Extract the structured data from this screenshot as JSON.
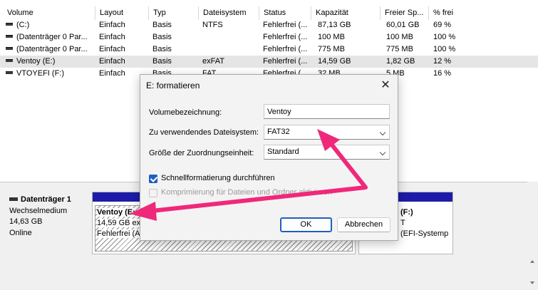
{
  "columns": [
    "Volume",
    "Layout",
    "Typ",
    "Dateisystem",
    "Status",
    "Kapazität",
    "Freier Sp...",
    "% frei"
  ],
  "volumes": [
    {
      "volume": "(C:)",
      "layout": "Einfach",
      "typ": "Basis",
      "fs": "NTFS",
      "status": "Fehlerfrei (...",
      "capacity": "87,13 GB",
      "free": "60,01 GB",
      "pct": "69 %"
    },
    {
      "volume": "(Datenträger 0 Par...",
      "layout": "Einfach",
      "typ": "Basis",
      "fs": "",
      "status": "Fehlerfrei (...",
      "capacity": "100 MB",
      "free": "100 MB",
      "pct": "100 %"
    },
    {
      "volume": "(Datenträger 0 Par...",
      "layout": "Einfach",
      "typ": "Basis",
      "fs": "",
      "status": "Fehlerfrei (...",
      "capacity": "775 MB",
      "free": "775 MB",
      "pct": "100 %"
    },
    {
      "volume": "Ventoy (E:)",
      "layout": "Einfach",
      "typ": "Basis",
      "fs": "exFAT",
      "status": "Fehlerfrei (...",
      "capacity": "14,59 GB",
      "free": "1,82 GB",
      "pct": "12 %"
    },
    {
      "volume": "VTOYEFI (F:)",
      "layout": "Einfach",
      "typ": "Basis",
      "fs": "FAT",
      "status": "Fehlerfrei (...",
      "capacity": "32 MB",
      "free": "5 MB",
      "pct": "16 %"
    }
  ],
  "disk": {
    "name": "Datenträger 1",
    "type": "Wechselmedium",
    "size": "14,63 GB",
    "state": "Online",
    "partitions": [
      {
        "name": "Ventoy  (E:",
        "line2": "14,59 GB ex",
        "line3": "Fehlerfrei (A"
      },
      {
        "name": "(F:)",
        "line2": "T",
        "line3": "(EFI-Systemp"
      }
    ]
  },
  "dialog": {
    "title": "E: formatieren",
    "close_glyph": "✕",
    "volume_label": "Volumebezeichnung:",
    "volume_value": "Ventoy",
    "fs_label": "Zu verwendendes Dateisystem:",
    "fs_value": "FAT32",
    "alloc_label": "Größe der Zuordnungseinheit:",
    "alloc_value": "Standard",
    "quick_format": "Schnellformatierung durchführen",
    "compress": "Komprimierung für Dateien und Ordner aktivieren",
    "ok": "OK",
    "cancel": "Abbrechen"
  },
  "colors": {
    "annotation_arrow": "#f0287a",
    "partition_bar": "#1c1ca8",
    "accent": "#1f5fbf"
  }
}
